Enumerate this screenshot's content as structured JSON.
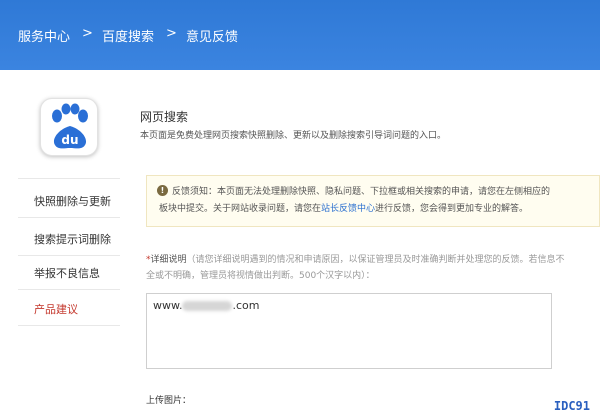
{
  "breadcrumb": {
    "items": [
      "服务中心",
      "百度搜索",
      "意见反馈"
    ],
    "separator": ">"
  },
  "sidebar": {
    "logo": {
      "icon": "baidu-paw-icon",
      "text": "du",
      "color": "#2a6fd6"
    },
    "items": [
      {
        "label": "快照删除与更新",
        "active": false
      },
      {
        "label": "搜索提示词删除",
        "active": false
      },
      {
        "label": "举报不良信息",
        "active": false
      },
      {
        "label": "产品建议",
        "active": true
      }
    ]
  },
  "main": {
    "title": "网页搜索",
    "description": "本页面是免费处理网页搜索快照删除、更新以及删除搜索引导词问题的入口。",
    "notice": {
      "icon": "info-icon",
      "line1": "反馈须知：本页面无法处理删除快照、隐私问题、下拉框或相关搜索的申请，请您在左侧相应的",
      "line2_before": "板块中提交。关于网站收录问题，请您在",
      "line2_link": "站长反馈中心",
      "line2_after": "进行反馈，您会得到更加专业的解答。"
    },
    "detail": {
      "required_mark": "*",
      "label": "详细说明",
      "hint_line1": "（请您详细说明遇到的情况和申请原因，以保证管理员及时准确判断并处理您的反馈。若信息不",
      "hint_line2": "全或不明确，管理员将视情做出判断。500个汉字以内）："
    },
    "textarea_value_prefix": "www.",
    "textarea_value_suffix": ".com",
    "upload_label": "上传图片："
  },
  "watermark": "IDC91",
  "colors": {
    "header": "#2f79d6",
    "active_item": "#c4372c",
    "link": "#2a6fcf"
  }
}
